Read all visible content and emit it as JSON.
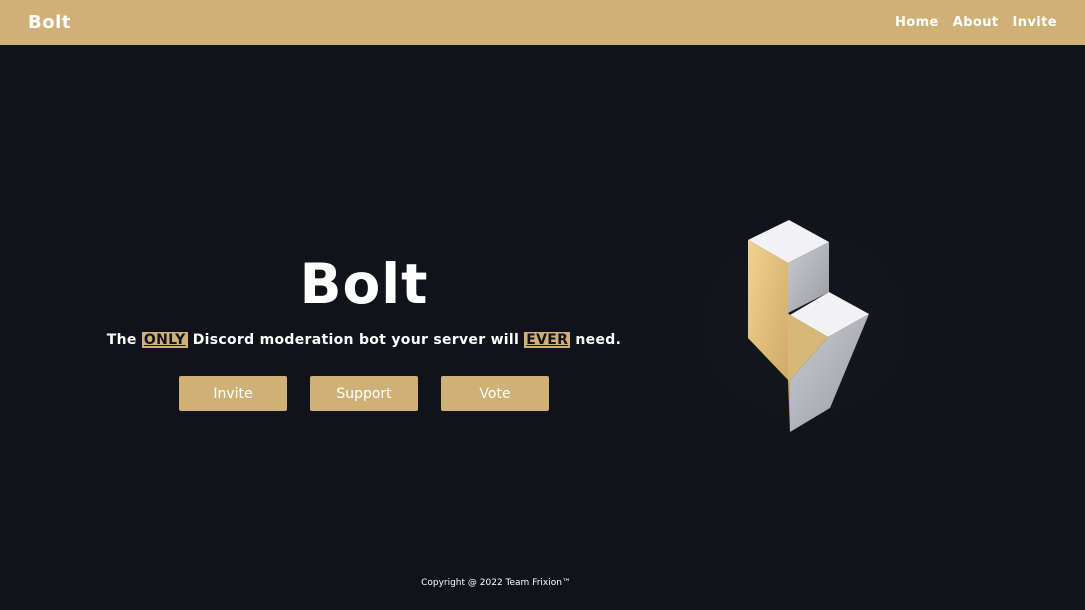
{
  "nav": {
    "brand": "Bolt",
    "links": [
      {
        "label": "Home"
      },
      {
        "label": "About"
      },
      {
        "label": "Invite"
      }
    ]
  },
  "hero": {
    "title": "Bolt",
    "tagline": {
      "part1": "The ",
      "highlight1": "ONLY",
      "part2": " Discord moderation bot your server will ",
      "highlight2": "EVER",
      "part3": " need."
    },
    "buttons": [
      {
        "label": "Invite"
      },
      {
        "label": "Support"
      },
      {
        "label": "Vote"
      }
    ]
  },
  "footer": {
    "copyright": "Copyright @ 2022 Team Frixion™"
  },
  "colors": {
    "background": "#11131a",
    "accent": "#cfb178",
    "text": "#ffffff"
  },
  "icons": {
    "logo": "bolt-logo-icon"
  }
}
